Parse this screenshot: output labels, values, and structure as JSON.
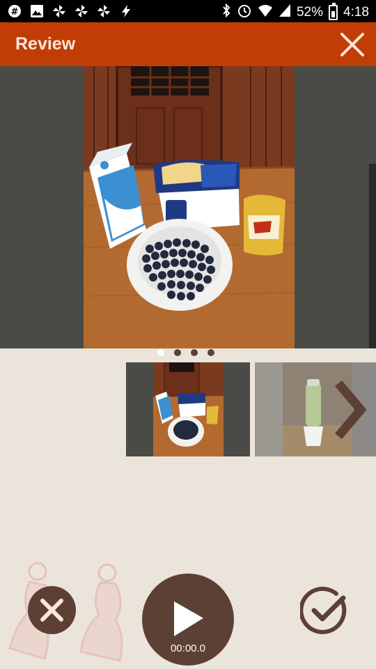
{
  "status_bar": {
    "battery": "52%",
    "time": "4:18",
    "left_icons": [
      "slack-icon",
      "gallery-icon",
      "pinwheel-icon",
      "pinwheel-icon",
      "pinwheel-icon",
      "flash-icon"
    ],
    "right_icons": [
      "bluetooth-icon",
      "alarm-icon",
      "wifi-icon",
      "signal-icon",
      "battery-icon"
    ]
  },
  "header": {
    "title": "Review",
    "close_icon": "close-icon"
  },
  "pager": {
    "count": 4,
    "active_index": 0
  },
  "controls": {
    "cancel_icon": "x-icon",
    "play_icon": "play-icon",
    "play_time": "00:00.0",
    "confirm_icon": "check-icon",
    "next_icon": "chevron-right-icon"
  },
  "colors": {
    "app_bar": "#c23c06",
    "title_text": "#fbe6da",
    "background": "#ebe4da",
    "control_brown": "#5c3f35"
  }
}
